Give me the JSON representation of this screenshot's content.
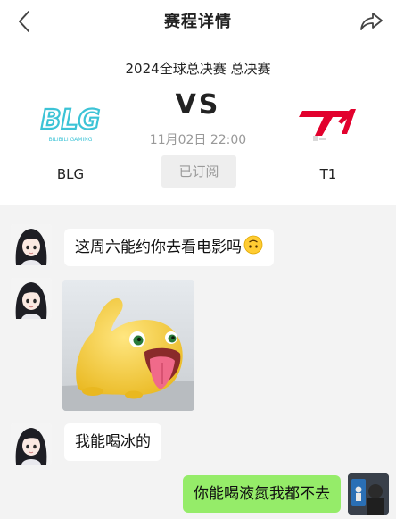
{
  "header": {
    "title": "赛程详情",
    "back_icon": "chevron-left-icon",
    "share_icon": "share-arrow-icon"
  },
  "match": {
    "event": "2024全球总决赛 总决赛",
    "vs": "VS",
    "time": "11月02日 22:00",
    "subscribe_label": "已订阅",
    "team_left": {
      "name": "BLG",
      "logo_text": "BLG",
      "logo_subtext": "BILIBILI GAMING",
      "color": "#3cc3d6"
    },
    "team_right": {
      "name": "T1",
      "color": "#e2012d"
    }
  },
  "chat": {
    "messages": [
      {
        "side": "left",
        "type": "text",
        "text": "这周六能约你去看电影吗",
        "emoji": "upside-down-face-icon"
      },
      {
        "side": "left",
        "type": "image",
        "image": "yellow-cartoon-creature-sticker"
      },
      {
        "side": "left",
        "type": "text",
        "text": "我能喝冰的"
      },
      {
        "side": "right",
        "type": "text",
        "text": "你能喝液氮我都不去"
      }
    ],
    "bubble_self_color": "#95ec69",
    "background_color": "#f3f3f3"
  }
}
